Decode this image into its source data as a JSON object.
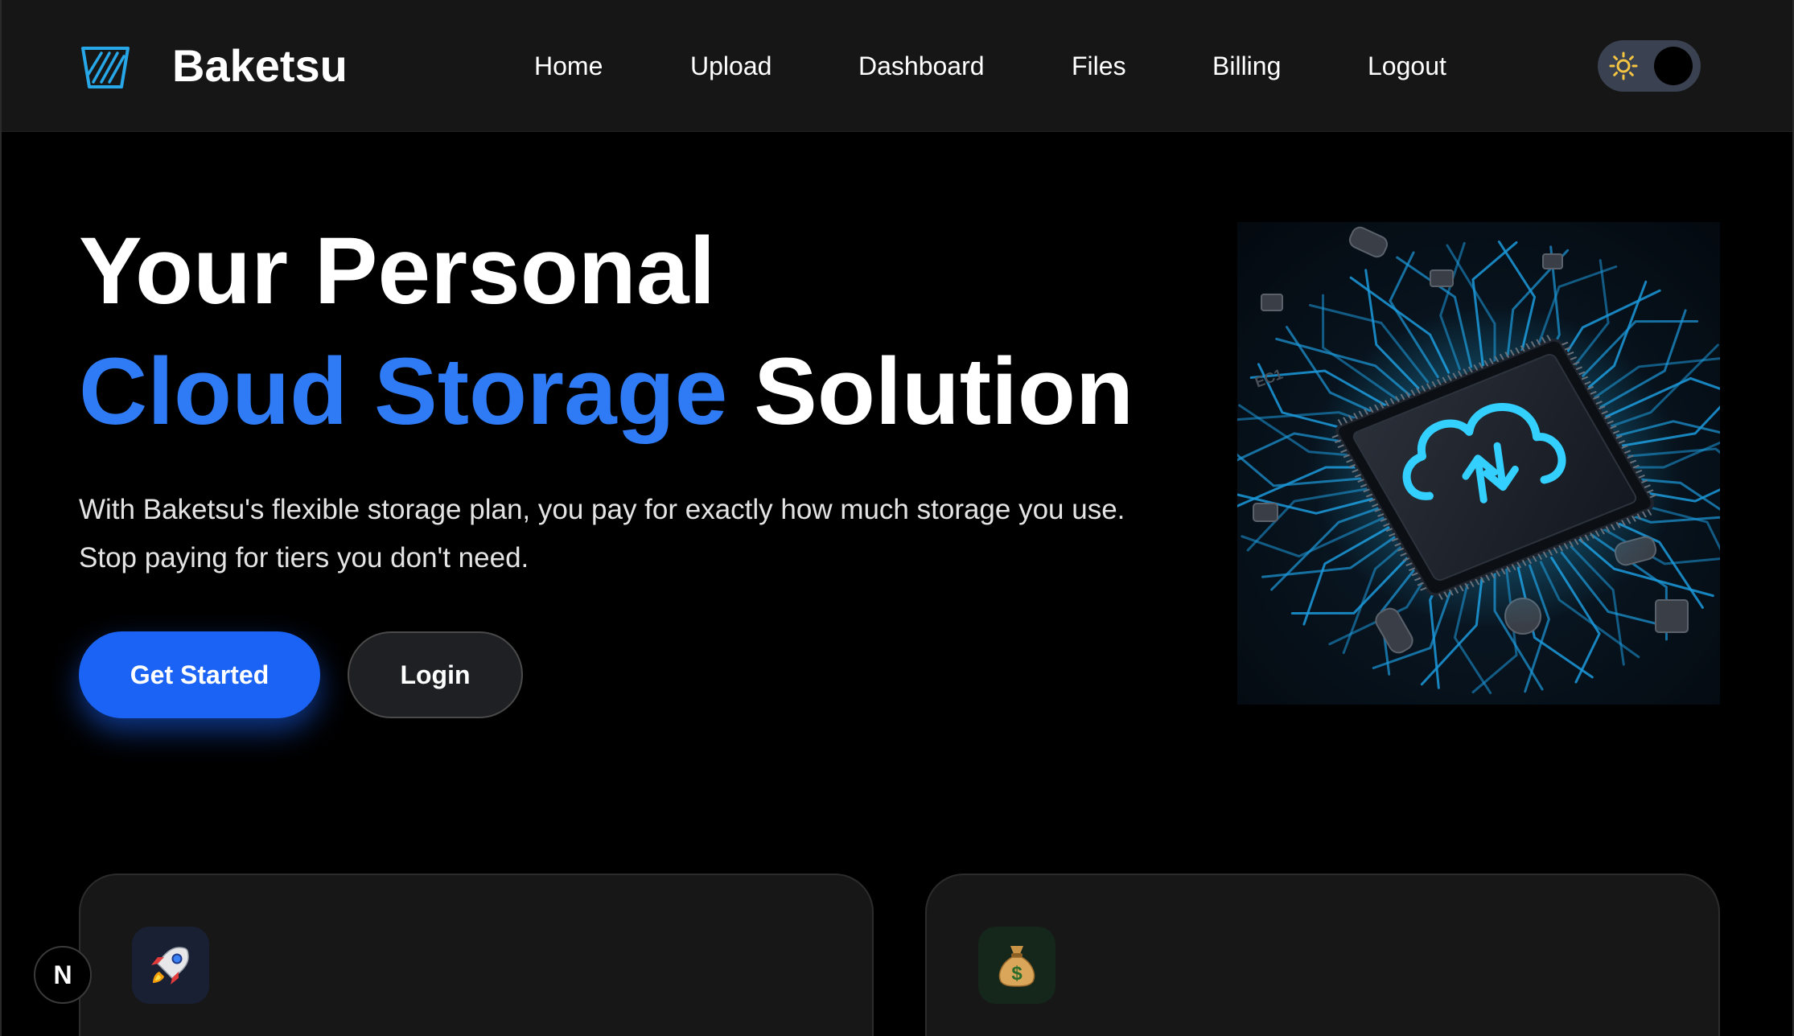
{
  "header": {
    "brand": "Baketsu",
    "logo_icon": "bucket-icon",
    "nav": [
      {
        "label": "Home"
      },
      {
        "label": "Upload"
      },
      {
        "label": "Dashboard"
      },
      {
        "label": "Files"
      },
      {
        "label": "Billing"
      },
      {
        "label": "Logout"
      }
    ],
    "theme_toggle": {
      "icon": "sun-icon",
      "state": "dark"
    }
  },
  "hero": {
    "title_line1": "Your Personal",
    "title_accent": "Cloud Storage",
    "title_rest": " Solution",
    "description_line1": "With Baketsu's flexible storage plan, you pay for exactly how much storage you use.",
    "description_line2": "Stop paying for tiers you don't need.",
    "primary_button": "Get Started",
    "secondary_button": "Login",
    "image_caption": "EC1"
  },
  "features": [
    {
      "icon": "rocket-icon",
      "icon_bg": "#192033"
    },
    {
      "icon": "money-bag-icon",
      "icon_bg": "#15261b"
    }
  ],
  "badge": {
    "label": "N"
  },
  "colors": {
    "accent": "#2f7bf6",
    "primary_button": "#1b63f5",
    "header_bg": "#161616",
    "page_bg": "#000000",
    "circuit": "#1fb6ff"
  }
}
